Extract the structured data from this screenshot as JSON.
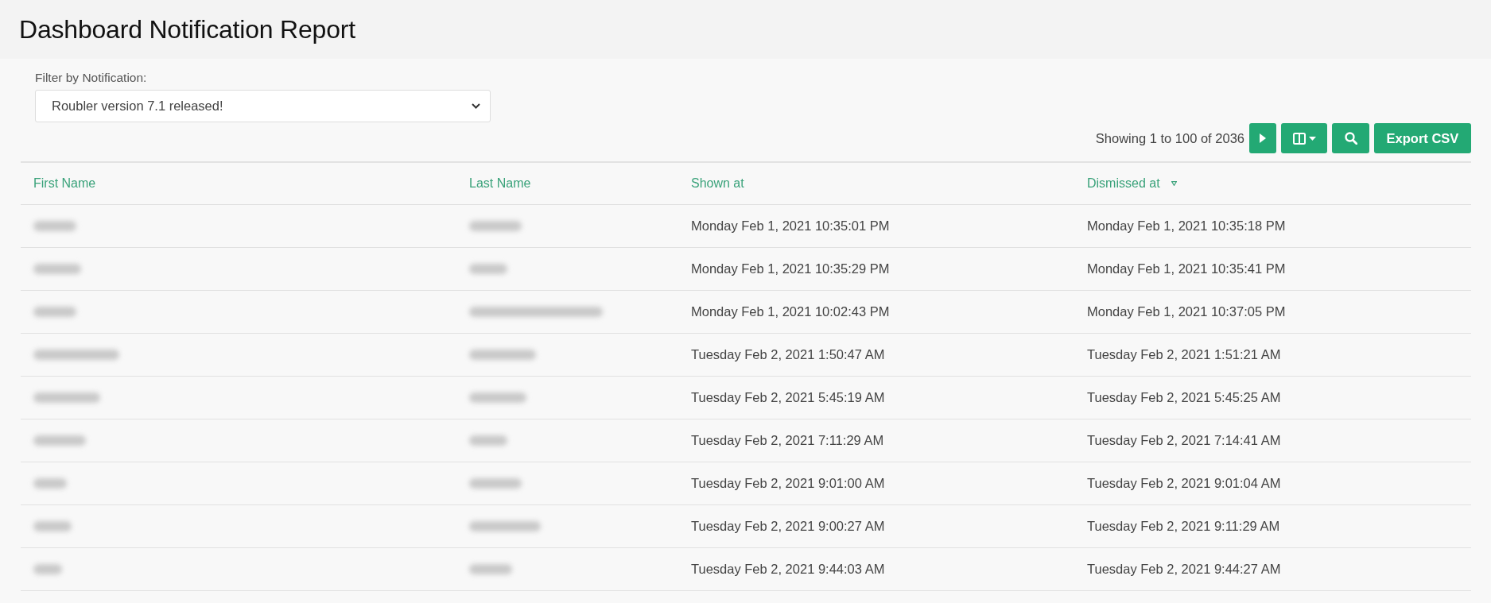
{
  "page": {
    "title": "Dashboard Notification Report"
  },
  "filter": {
    "label": "Filter by Notification:",
    "value": "Roubler version 7.1 released!"
  },
  "toolbar": {
    "summary": "Showing 1 to 100 of 2036",
    "buttons": [
      {
        "kind": "next"
      },
      {
        "kind": "columns"
      },
      {
        "kind": "search"
      },
      {
        "kind": "export",
        "label": "Export CSV"
      }
    ]
  },
  "table": {
    "columns": [
      {
        "label": "First Name",
        "sorted": false
      },
      {
        "label": "Last Name",
        "sorted": false
      },
      {
        "label": "Shown at",
        "sorted": false
      },
      {
        "label": "Dismissed at",
        "sorted": true
      }
    ],
    "rows": [
      {
        "first_name": {
          "redacted": true
        },
        "last_name": {
          "redacted": true
        },
        "shown_at": "Monday Feb 1, 2021 10:35:01 PM",
        "dismissed_at": "Monday Feb 1, 2021 10:35:18 PM"
      },
      {
        "first_name": {
          "redacted": true
        },
        "last_name": {
          "redacted": true
        },
        "shown_at": "Monday Feb 1, 2021 10:35:29 PM",
        "dismissed_at": "Monday Feb 1, 2021 10:35:41 PM"
      },
      {
        "first_name": {
          "redacted": true
        },
        "last_name": {
          "redacted": true
        },
        "shown_at": "Monday Feb 1, 2021 10:02:43 PM",
        "dismissed_at": "Monday Feb 1, 2021 10:37:05 PM"
      },
      {
        "first_name": {
          "redacted": true
        },
        "last_name": {
          "redacted": true
        },
        "shown_at": "Tuesday Feb 2, 2021 1:50:47 AM",
        "dismissed_at": "Tuesday Feb 2, 2021 1:51:21 AM"
      },
      {
        "first_name": {
          "redacted": true
        },
        "last_name": {
          "redacted": true
        },
        "shown_at": "Tuesday Feb 2, 2021 5:45:19 AM",
        "dismissed_at": "Tuesday Feb 2, 2021 5:45:25 AM"
      },
      {
        "first_name": {
          "redacted": true
        },
        "last_name": {
          "redacted": true
        },
        "shown_at": "Tuesday Feb 2, 2021 7:11:29 AM",
        "dismissed_at": "Tuesday Feb 2, 2021 7:14:41 AM"
      },
      {
        "first_name": {
          "redacted": true
        },
        "last_name": {
          "redacted": true
        },
        "shown_at": "Tuesday Feb 2, 2021 9:01:00 AM",
        "dismissed_at": "Tuesday Feb 2, 2021 9:01:04 AM"
      },
      {
        "first_name": {
          "redacted": true
        },
        "last_name": {
          "redacted": true
        },
        "shown_at": "Tuesday Feb 2, 2021 9:00:27 AM",
        "dismissed_at": "Tuesday Feb 2, 2021 9:11:29 AM"
      },
      {
        "first_name": {
          "redacted": true
        },
        "last_name": {
          "redacted": true
        },
        "shown_at": "Tuesday Feb 2, 2021 9:44:03 AM",
        "dismissed_at": "Tuesday Feb 2, 2021 9:44:27 AM"
      }
    ]
  }
}
